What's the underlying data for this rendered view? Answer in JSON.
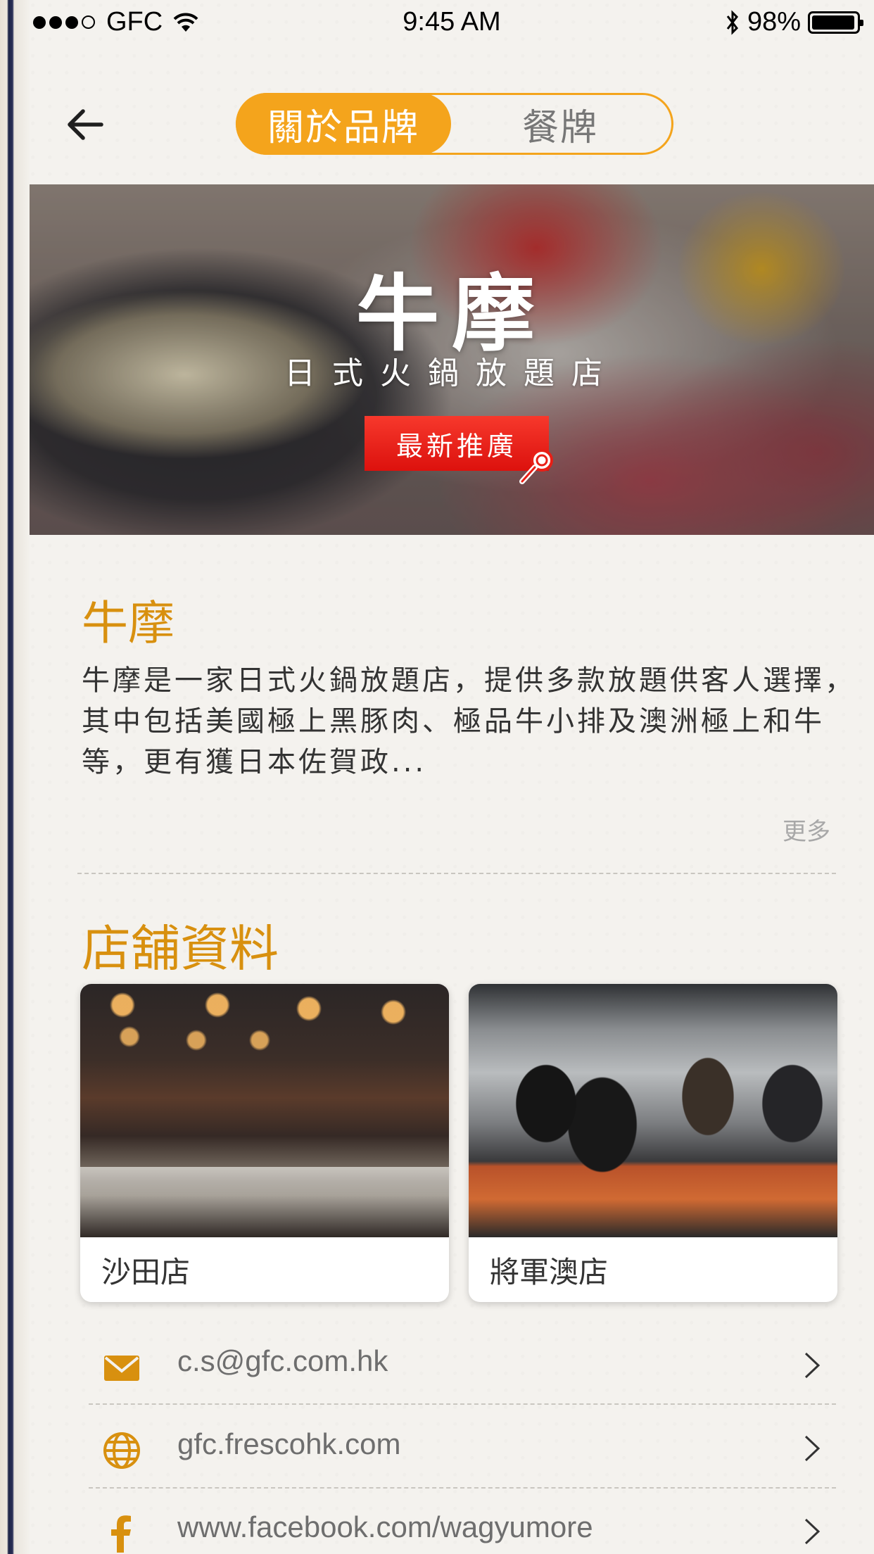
{
  "status_bar": {
    "carrier": "GFC",
    "time": "9:45 AM",
    "battery_pct": "98%",
    "battery_level": 0.98,
    "icons": [
      "signal-dots-icon",
      "wifi-icon",
      "bluetooth-icon",
      "battery-icon"
    ]
  },
  "nav": {
    "back_icon": "arrow-left-icon",
    "tabs": [
      {
        "label": "關於品牌",
        "active": true
      },
      {
        "label": "餐牌",
        "active": false
      }
    ]
  },
  "hero": {
    "title": "牛摩",
    "subtitle": "日式火鍋放題店",
    "promo_label": "最新推廣",
    "promo_icon": "magnifier-icon"
  },
  "brand": {
    "heading": "牛摩",
    "description": "牛摩是一家日式火鍋放題店，提供多款放題供客人選擇，其中包括美國極上黑豚肉、極品牛小排及澳洲極上和牛等，更有獲日本佐賀政...",
    "more_label": "更多"
  },
  "stores": {
    "heading": "店舖資料",
    "items": [
      {
        "name": "沙田店"
      },
      {
        "name": "將軍澳店"
      }
    ]
  },
  "contacts": [
    {
      "icon": "mail-icon",
      "text": "c.s@gfc.com.hk"
    },
    {
      "icon": "globe-icon",
      "text": "gfc.frescohk.com"
    },
    {
      "icon": "facebook-icon",
      "text": "www.facebook.com/wagyumore"
    }
  ],
  "colors": {
    "accent": "#f4a41c",
    "heading": "#d8900f",
    "promo_red": "#e02118",
    "background": "#f4f2ee"
  }
}
